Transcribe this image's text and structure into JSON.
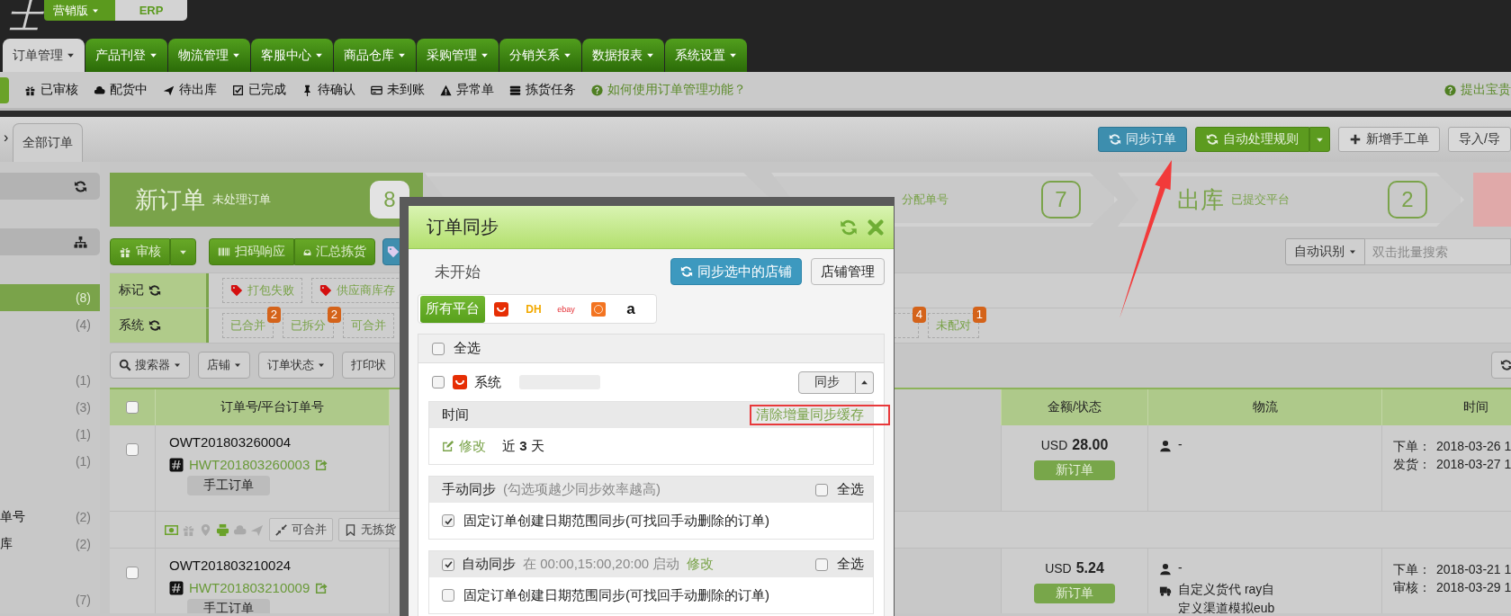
{
  "header": {
    "logo": "士",
    "edition_menu": "营销版",
    "erp_tab": "ERP"
  },
  "nav_tabs": [
    {
      "label": "订单管理",
      "selected": true
    },
    {
      "label": "产品刊登",
      "selected": false
    },
    {
      "label": "物流管理",
      "selected": false
    },
    {
      "label": "客服中心",
      "selected": false
    },
    {
      "label": "商品仓库",
      "selected": false
    },
    {
      "label": "采购管理",
      "selected": false
    },
    {
      "label": "分销关系",
      "selected": false
    },
    {
      "label": "数据报表",
      "selected": false
    },
    {
      "label": "系统设置",
      "selected": false
    }
  ],
  "subnav": {
    "items": [
      "已审核",
      "配货中",
      "待出库",
      "已完成",
      "待确认",
      "未到账",
      "异常单",
      "拣货任务"
    ],
    "help_link": "如何使用订单管理功能？",
    "feedback_link": "提出宝贵"
  },
  "breadcrumb": {
    "expander": "›",
    "tab": "全部订单"
  },
  "actions": [
    {
      "label": "同步订单",
      "kind": "info",
      "split": false
    },
    {
      "label": "自动处理规则",
      "kind": "success",
      "split": true
    },
    {
      "label": "新增手工单",
      "kind": "default",
      "split": false
    },
    {
      "label": "导入/导",
      "kind": "default",
      "split": false
    }
  ],
  "sidebar": {
    "items": [
      {
        "kind": "header"
      },
      {
        "kind": "gap"
      },
      {
        "kind": "header"
      },
      {
        "kind": "gap"
      },
      {
        "kind": "item",
        "count": "(8)",
        "selected": true
      },
      {
        "kind": "item",
        "count": "(4)",
        "selected": false
      },
      {
        "kind": "gap"
      },
      {
        "kind": "item",
        "count": "(1)",
        "selected": false
      },
      {
        "kind": "item",
        "count": "(3)",
        "selected": false
      },
      {
        "kind": "item",
        "count": "(1)",
        "selected": false
      },
      {
        "kind": "item",
        "count": "(1)",
        "selected": false
      },
      {
        "kind": "gap"
      },
      {
        "kind": "item",
        "label": "单号",
        "count": "(2)",
        "selected": false
      },
      {
        "kind": "item",
        "label": "库",
        "count": "(2)",
        "selected": false
      },
      {
        "kind": "gap"
      },
      {
        "kind": "item",
        "count": "(7)",
        "selected": false
      }
    ]
  },
  "status_cards": [
    {
      "kind": "active",
      "title": "新订单",
      "subtitle": "未处理订单",
      "count": "8"
    },
    {
      "kind": "plain"
    },
    {
      "kind": "plain",
      "subtitle": "分配单号",
      "count": "7"
    },
    {
      "kind": "plain",
      "title": "出库",
      "subtitle": "已提交平台",
      "count": "2"
    },
    {
      "kind": "alert"
    }
  ],
  "order_toolbar": {
    "review_button": "审核",
    "scan_button": "扫码响应",
    "summary_button": "汇总拣货",
    "search_mode": "自动识别",
    "search": {
      "placeholder": "双击批量搜索"
    }
  },
  "tag_rows": [
    {
      "label": "标记",
      "tags": [
        {
          "kind": "flag",
          "label": "打包失败"
        },
        {
          "kind": "flag",
          "label": "供应商库存"
        }
      ]
    },
    {
      "label": "系统",
      "tags": [
        {
          "kind": "count",
          "label": "已合并",
          "badge": "2"
        },
        {
          "kind": "count",
          "label": "已拆分",
          "badge": "2"
        },
        {
          "kind": "count",
          "label": "可合并"
        },
        {
          "kind": "count",
          "badge": "4"
        },
        {
          "kind": "count",
          "label": "未配对",
          "badge": "1"
        }
      ]
    }
  ],
  "filters": [
    {
      "label": "搜索器",
      "dropdown": true
    },
    {
      "label": "店铺",
      "dropdown": true
    },
    {
      "label": "订单状态",
      "dropdown": true
    },
    {
      "label": "打印状",
      "dropdown": false
    }
  ],
  "table": {
    "columns": [
      {
        "kind": "check",
        "checked": false
      },
      {
        "label": "订单号/平台订单号"
      },
      {
        "label": "金额/状态"
      },
      {
        "label": "物流"
      },
      {
        "label": "时间"
      }
    ],
    "rows": [
      {
        "checked": false,
        "order_no": "OWT201803260004",
        "platform_order_no": "HWT201803260003",
        "tag": "手工订单",
        "currency": "USD",
        "amount": "28.00",
        "status": "新订单",
        "logistics": [
          {
            "kind": "person",
            "text": "-"
          }
        ],
        "times": [
          {
            "label": "下单：",
            "value": "2018-03-26 1"
          },
          {
            "label": "发货：",
            "value": "2018-03-27 1"
          }
        ],
        "actions": [
          "可合并",
          "无拣货"
        ]
      },
      {
        "checked": false,
        "order_no": "OWT201803210024",
        "platform_order_no": "HWT201803210009",
        "tag": "手工订单",
        "currency": "USD",
        "amount": "5.24",
        "status": "新订单",
        "logistics": [
          {
            "kind": "person",
            "text": "-"
          },
          {
            "kind": "truck",
            "text": "自定义货代 ray自定义渠道模拟eub"
          }
        ],
        "times": [
          {
            "label": "下单：",
            "value": "2018-03-21 1"
          },
          {
            "label": "审核：",
            "value": "2018-03-29 1"
          }
        ]
      }
    ]
  },
  "modal": {
    "title": "订单同步",
    "status": "未开始",
    "sync_button": "同步选中的店铺",
    "manage_button": "店铺管理",
    "platforms": [
      {
        "kind": "text",
        "label": "所有平台",
        "selected": true
      },
      {
        "kind": "logo",
        "selected": false
      },
      {
        "kind": "wordmark",
        "label": "DH",
        "selected": false
      },
      {
        "kind": "wordmark",
        "label": "ebay",
        "selected": false
      },
      {
        "kind": "logo",
        "selected": false
      },
      {
        "kind": "wordmark",
        "label": "a",
        "selected": false
      }
    ],
    "select_all": {
      "label": "全选",
      "checked": false
    },
    "stores": [
      {
        "name": "系统",
        "checked": false,
        "sync_button": "同步",
        "time_label": "时间",
        "clear_cache_link": "清除增量同步缓存",
        "edit_link": "修改",
        "range": "近 **3** 天",
        "manual": {
          "title": "手动同步",
          "hint": "(勾选项越少同步效率越高)",
          "select_all": {
            "label": "全选",
            "checked": false
          },
          "options": [
            {
              "label": "固定订单创建日期范围同步(可找回手动删除的订单)",
              "checked": true
            }
          ]
        },
        "auto": {
          "title": "自动同步",
          "checked": true,
          "schedule": "在 00:00,15:00,20:00 启动",
          "edit_link": "修改",
          "select_all": {
            "label": "全选",
            "checked": false
          },
          "options": [
            {
              "label": "固定订单创建日期范围同步(可找回手动删除的订单)",
              "checked": false
            }
          ]
        }
      }
    ]
  }
}
